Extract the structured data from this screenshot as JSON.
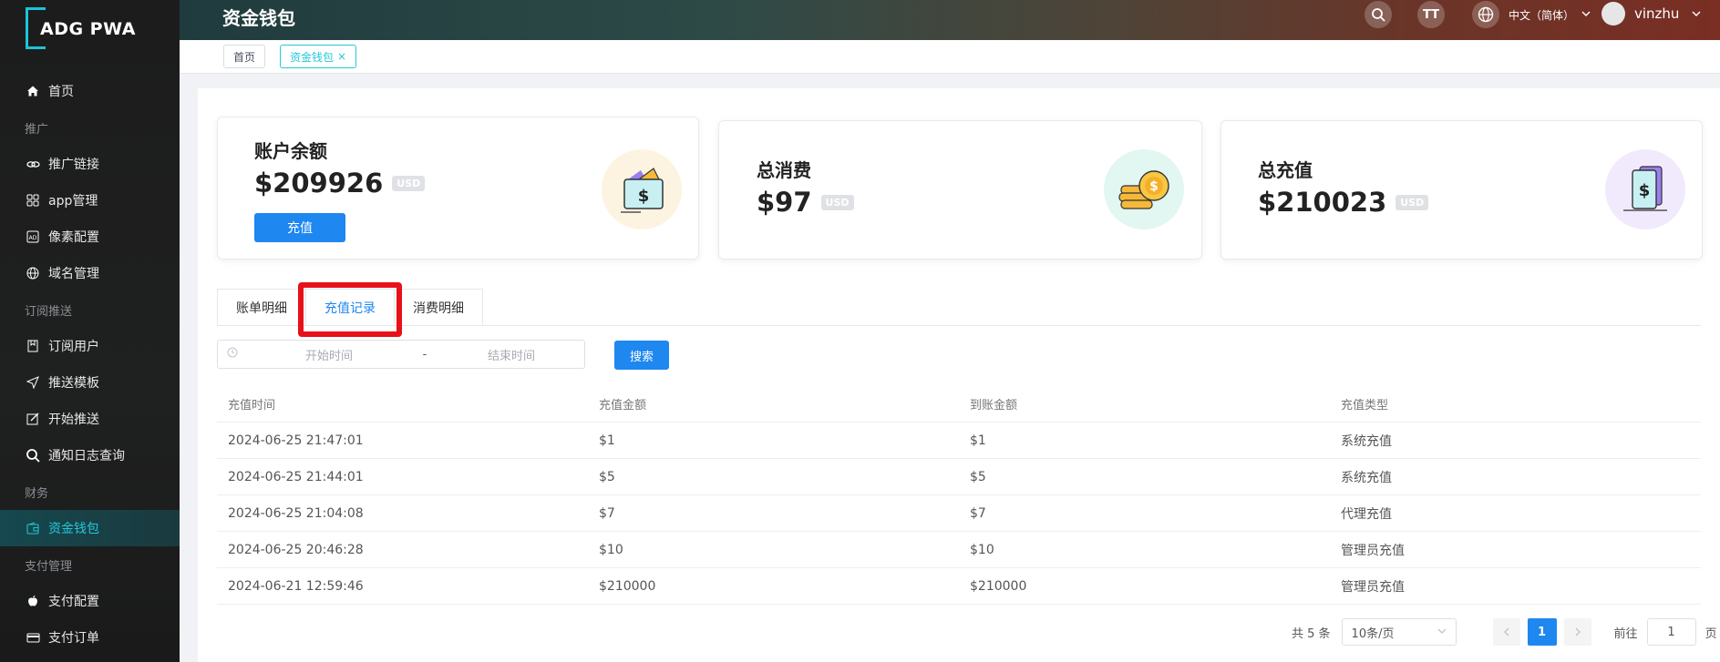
{
  "app": {
    "logo_text": "ADG PWA"
  },
  "sidebar": {
    "items": [
      {
        "type": "item",
        "label": "首页",
        "icon": "home-icon"
      },
      {
        "type": "group",
        "label": "推广"
      },
      {
        "type": "item",
        "label": "推广链接",
        "icon": "link-icon"
      },
      {
        "type": "item",
        "label": "app管理",
        "icon": "grid-icon"
      },
      {
        "type": "item",
        "label": "像素配置",
        "icon": "ad-icon"
      },
      {
        "type": "item",
        "label": "域名管理",
        "icon": "globe-icon"
      },
      {
        "type": "group",
        "label": "订阅推送"
      },
      {
        "type": "item",
        "label": "订阅用户",
        "icon": "bookmark-icon"
      },
      {
        "type": "item",
        "label": "推送模板",
        "icon": "send-icon"
      },
      {
        "type": "item",
        "label": "开始推送",
        "icon": "edit-icon"
      },
      {
        "type": "item",
        "label": "通知日志查询",
        "icon": "search-log-icon"
      },
      {
        "type": "group",
        "label": "财务"
      },
      {
        "type": "item",
        "label": "资金钱包",
        "icon": "wallet-icon",
        "active": true
      },
      {
        "type": "group",
        "label": "支付管理"
      },
      {
        "type": "item",
        "label": "支付配置",
        "icon": "apple-icon"
      },
      {
        "type": "item",
        "label": "支付订单",
        "icon": "card-icon"
      }
    ]
  },
  "header": {
    "title": "资金钱包",
    "language": "中文（简体）",
    "username": "vinzhu",
    "font_size_glyph": "TT"
  },
  "tags": {
    "home": "首页",
    "current": "资金钱包",
    "close": "×"
  },
  "stats": {
    "balance": {
      "title": "账户余额",
      "value": "$209926",
      "currency": "USD",
      "button": "充值"
    },
    "spent": {
      "title": "总消费",
      "value": "$97",
      "currency": "USD"
    },
    "recharged": {
      "title": "总充值",
      "value": "$210023",
      "currency": "USD"
    }
  },
  "tabs": [
    "账单明细",
    "充值记录",
    "消费明细"
  ],
  "active_tab": 1,
  "filter": {
    "start_placeholder": "开始时间",
    "separator": "-",
    "end_placeholder": "结束时间",
    "search_button": "搜索"
  },
  "table": {
    "headers": [
      "充值时间",
      "充值金额",
      "到账金额",
      "充值类型"
    ],
    "rows": [
      [
        "2024-06-25 21:47:01",
        "$1",
        "$1",
        "系统充值"
      ],
      [
        "2024-06-25 21:44:01",
        "$5",
        "$5",
        "系统充值"
      ],
      [
        "2024-06-25 21:04:08",
        "$7",
        "$7",
        "代理充值"
      ],
      [
        "2024-06-25 20:46:28",
        "$10",
        "$10",
        "管理员充值"
      ],
      [
        "2024-06-21 12:59:46",
        "$210000",
        "$210000",
        "管理员充值"
      ]
    ]
  },
  "pagination": {
    "total": "共 5 条",
    "page_size": "10条/页",
    "current_page": "1",
    "goto_label": "前往",
    "goto_value": "1",
    "page_suffix": "页"
  },
  "colors": {
    "accent": "#1e87f0",
    "sidebar_active": "#22c8d8",
    "highlight": "#e8101a"
  }
}
